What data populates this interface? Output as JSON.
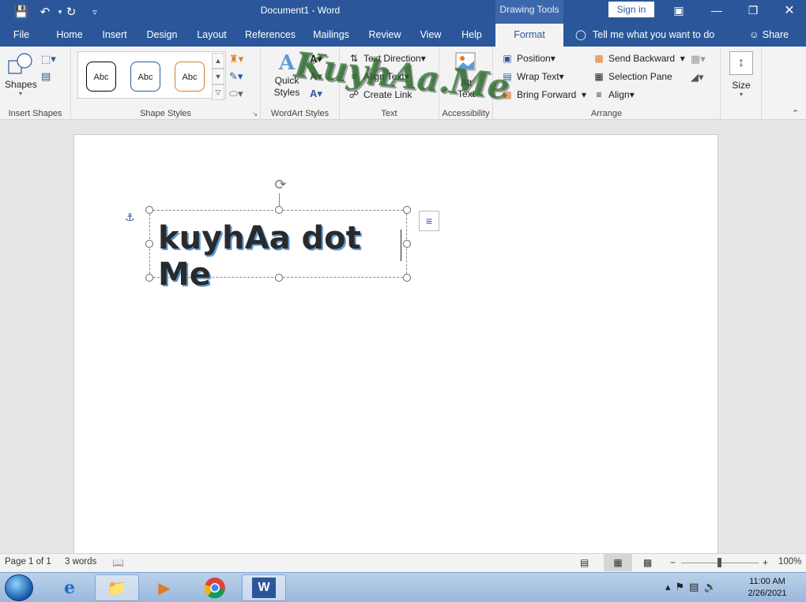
{
  "title_bar": {
    "document_title": "Document1  -  Word",
    "contextual_tab_group": "Drawing Tools",
    "sign_in_label": "Sign in"
  },
  "tabs": [
    {
      "label": "File"
    },
    {
      "label": "Home"
    },
    {
      "label": "Insert"
    },
    {
      "label": "Design"
    },
    {
      "label": "Layout"
    },
    {
      "label": "References"
    },
    {
      "label": "Mailings"
    },
    {
      "label": "Review"
    },
    {
      "label": "View"
    },
    {
      "label": "Help"
    },
    {
      "label": "Format",
      "active": true
    }
  ],
  "tell_me": "Tell me what you want to do",
  "share_label": "Share",
  "ribbon": {
    "insert_shapes": {
      "label": "Insert Shapes",
      "shapes_label": "Shapes"
    },
    "shape_styles": {
      "label": "Shape Styles",
      "presets": [
        "Abc",
        "Abc",
        "Abc"
      ]
    },
    "wordart_styles": {
      "label": "WordArt Styles",
      "quick_styles_label": "Quick Styles"
    },
    "text": {
      "label": "Text",
      "text_direction": "Text Direction",
      "align_text": "Align Text",
      "create_link": "Create Link"
    },
    "accessibility": {
      "label": "Accessibility",
      "alt_text": "Alt Text"
    },
    "arrange": {
      "label": "Arrange",
      "position": "Position",
      "wrap_text": "Wrap Text",
      "bring_forward": "Bring Forward",
      "send_backward": "Send Backward",
      "selection_pane": "Selection Pane",
      "align": "Align"
    },
    "size": {
      "label": "Size"
    }
  },
  "watermark_text": "KuyhAa.Me",
  "document": {
    "textbox_text": "kuyhAa dot Me"
  },
  "status_bar": {
    "page": "Page 1 of 1",
    "words": "3 words",
    "zoom": "100%"
  },
  "taskbar": {
    "time": "11:00 AM",
    "date": "2/26/2021"
  },
  "colors": {
    "word_blue": "#2b579a",
    "ribbon_bg": "#f3f3f3",
    "text_shadow": "#5b9bd5"
  }
}
